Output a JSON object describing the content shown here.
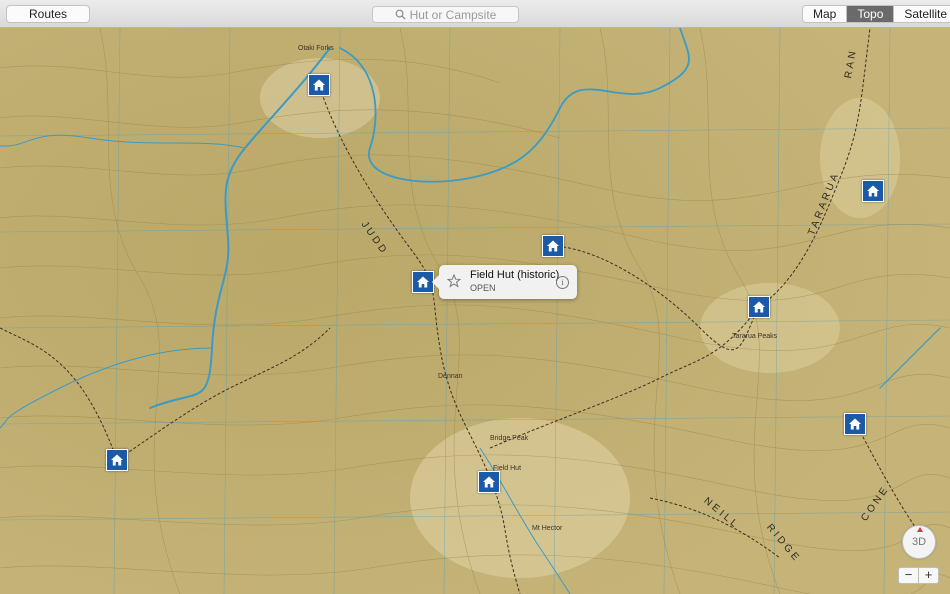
{
  "toolbar": {
    "routes_label": "Routes",
    "search_placeholder": "Hut or Campsite",
    "map_types": [
      "Map",
      "Topo",
      "Satellite"
    ],
    "active_map_type": "Topo"
  },
  "popup": {
    "title": "Field Hut (historic)",
    "status": "OPEN",
    "info_glyph": "i"
  },
  "controls": {
    "view_3d_label": "3D",
    "zoom_out": "−",
    "zoom_in": "+"
  },
  "map_labels": {
    "otaki_forks": "Otaki Forks",
    "tararua": "TARARUA",
    "ran": "RAN",
    "neill": "NEILL",
    "ridge_1": "RIDGE",
    "cone": "CONE",
    "mt_hector": "Mt Hector",
    "judd": "JUDD",
    "dennan": "Dennan",
    "field_hut": "Field Hut",
    "bridge_peak": "Bridge Peak",
    "tararua_peaks": "Tararua Peaks"
  },
  "colors": {
    "hut_marker": "#1a5aa6",
    "river": "#3a9bc7",
    "topo_base": "#c9b57c",
    "contour": "#9a7e43",
    "track": "#3d2f1e"
  }
}
